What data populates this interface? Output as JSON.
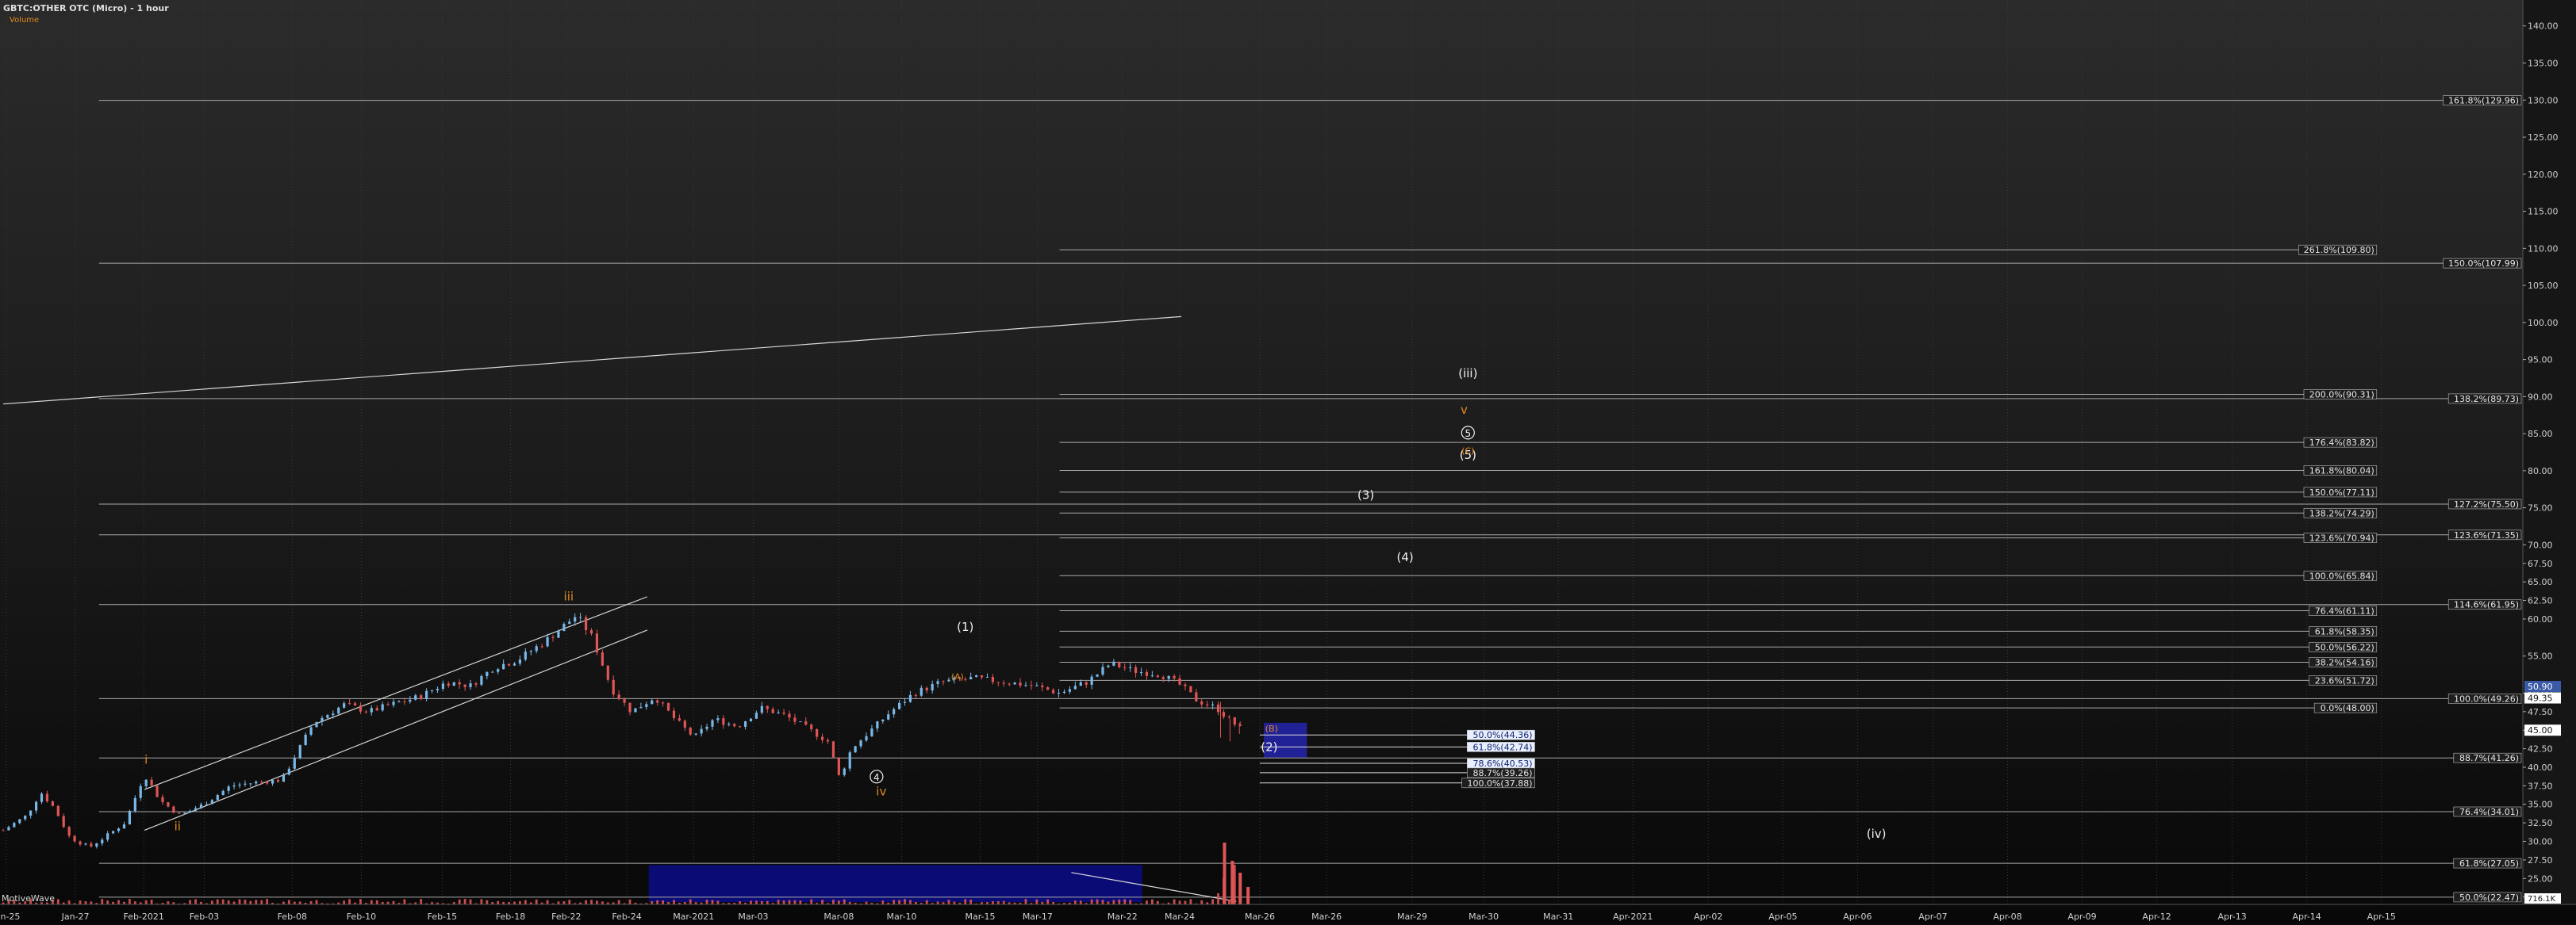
{
  "header": {
    "title": "GBTC:OTHER OTC (Micro) - 1 hour",
    "subtitle": "Volume"
  },
  "watermark": "MotiveWave",
  "colors": {
    "up_candle": "#7ab8e8",
    "down_candle": "#e05555",
    "volume": "#e05555",
    "fib_line": "#a8a8a8",
    "wave_orange": "#e08a1e",
    "wave_white": "#f0f0f0",
    "zone_blue": "#0c0c8a",
    "zone_blue_small": "#2a2ad0",
    "last_price_bg": "#3a5aa8"
  },
  "chart_data": {
    "type": "candlestick",
    "title": "GBTC:OTHER OTC (Micro) - 1 hour",
    "price_range": [
      21.5,
      143.5
    ],
    "y_ticks": [
      "22.50",
      "25.00",
      "27.50",
      "30.00",
      "32.50",
      "35.00",
      "37.50",
      "40.00",
      "42.50",
      "45.00",
      "47.50",
      "50.00",
      "55.00",
      "60.00",
      "62.50",
      "65.00",
      "67.50",
      "70.00",
      "75.00",
      "80.00",
      "85.00",
      "90.00",
      "95.00",
      "100.00",
      "105.00",
      "110.00",
      "115.00",
      "120.00",
      "125.00",
      "130.00",
      "135.00",
      "140.00"
    ],
    "x_ticks": [
      {
        "label": "Jan-25",
        "t": 0.04
      },
      {
        "label": "Jan-27",
        "t": 0.92
      },
      {
        "label": "Feb-2021",
        "t": 1.79
      },
      {
        "label": "Feb-03",
        "t": 2.56
      },
      {
        "label": "Feb-08",
        "t": 3.68
      },
      {
        "label": "Feb-10",
        "t": 4.56
      },
      {
        "label": "Feb-15",
        "t": 5.59
      },
      {
        "label": "Feb-18",
        "t": 6.46
      },
      {
        "label": "Feb-22",
        "t": 7.17
      },
      {
        "label": "Feb-24",
        "t": 7.94
      },
      {
        "label": "Mar-2021",
        "t": 8.79
      },
      {
        "label": "Mar-03",
        "t": 9.55
      },
      {
        "label": "Mar-08",
        "t": 10.64
      },
      {
        "label": "Mar-10",
        "t": 11.44
      },
      {
        "label": "Mar-15",
        "t": 12.44
      },
      {
        "label": "Mar-17",
        "t": 13.17
      },
      {
        "label": "Mar-22",
        "t": 14.25
      },
      {
        "label": "Mar-24",
        "t": 14.98
      },
      {
        "label": "Mar-26",
        "t": 16.0
      },
      {
        "label": "Mar-26",
        "t": 16.85
      },
      {
        "label": "Mar-29",
        "t": 17.94
      },
      {
        "label": "Mar-30",
        "t": 18.85
      },
      {
        "label": "Mar-31",
        "t": 19.8
      },
      {
        "label": "Apr-2021",
        "t": 20.75
      },
      {
        "label": "Apr-02",
        "t": 21.71
      },
      {
        "label": "Apr-05",
        "t": 22.66
      },
      {
        "label": "Apr-06",
        "t": 23.61
      },
      {
        "label": "Apr-07",
        "t": 24.57
      },
      {
        "label": "Apr-08",
        "t": 25.52
      },
      {
        "label": "Apr-09",
        "t": 26.47
      },
      {
        "label": "Apr-12",
        "t": 27.42
      },
      {
        "label": "Apr-13",
        "t": 28.38
      },
      {
        "label": "Apr-14",
        "t": 29.33
      },
      {
        "label": "Apr-15",
        "t": 30.28
      }
    ],
    "price_path": [
      [
        0.0,
        31.5
      ],
      [
        0.3,
        33.5
      ],
      [
        0.48,
        36.6
      ],
      [
        0.65,
        34.5
      ],
      [
        0.85,
        30.5
      ],
      [
        1.1,
        29.2
      ],
      [
        1.35,
        31.0
      ],
      [
        1.55,
        32.5
      ],
      [
        1.8,
        39.0
      ],
      [
        2.0,
        35.5
      ],
      [
        2.25,
        33.5
      ],
      [
        2.55,
        35.0
      ],
      [
        2.9,
        37.5
      ],
      [
        3.25,
        38.0
      ],
      [
        3.55,
        38.3
      ],
      [
        3.95,
        46.0
      ],
      [
        4.35,
        48.5
      ],
      [
        4.65,
        47.5
      ],
      [
        4.95,
        48.5
      ],
      [
        5.3,
        49.5
      ],
      [
        5.65,
        51.5
      ],
      [
        5.95,
        51.0
      ],
      [
        6.25,
        53.5
      ],
      [
        6.55,
        54.5
      ],
      [
        6.9,
        57.0
      ],
      [
        7.3,
        60.5
      ],
      [
        7.5,
        57.5
      ],
      [
        7.75,
        50.5
      ],
      [
        8.0,
        47.5
      ],
      [
        8.3,
        49.5
      ],
      [
        8.55,
        46.5
      ],
      [
        8.8,
        44.0
      ],
      [
        9.05,
        46.5
      ],
      [
        9.35,
        45.5
      ],
      [
        9.65,
        48.0
      ],
      [
        9.95,
        47.0
      ],
      [
        10.2,
        45.5
      ],
      [
        10.5,
        43.5
      ],
      [
        10.65,
        38.5
      ],
      [
        10.8,
        42.5
      ],
      [
        11.0,
        44.5
      ],
      [
        11.3,
        47.5
      ],
      [
        11.6,
        50.0
      ],
      [
        11.95,
        51.5
      ],
      [
        12.35,
        52.0
      ],
      [
        12.75,
        51.5
      ],
      [
        13.1,
        51.0
      ],
      [
        13.45,
        50.0
      ],
      [
        13.8,
        51.5
      ],
      [
        14.1,
        54.0
      ],
      [
        14.4,
        53.0
      ],
      [
        14.75,
        52.5
      ],
      [
        15.0,
        51.0
      ],
      [
        15.2,
        49.0
      ],
      [
        15.45,
        48.0
      ],
      [
        15.6,
        46.5
      ],
      [
        15.8,
        44.8
      ]
    ],
    "zones": [
      {
        "t0": 8.22,
        "t1": 14.5,
        "p0": 21.8,
        "p1": 26.8
      },
      {
        "t0": 16.05,
        "t1": 16.6,
        "p0": 41.3,
        "p1": 46.0
      }
    ],
    "fib_lines_left": [
      {
        "t0": 1.22,
        "p": 129.96,
        "label": "161.8%(129.96)"
      },
      {
        "t0": 1.22,
        "p": 107.99,
        "label": "150.0%(107.99)"
      },
      {
        "t0": 1.22,
        "p": 89.73,
        "label": "138.2%(89.73)"
      },
      {
        "t0": 1.22,
        "p": 75.5,
        "label": "127.2%(75.50)"
      },
      {
        "t0": 1.22,
        "p": 71.35,
        "label": "123.6%(71.35)"
      },
      {
        "t0": 1.22,
        "p": 61.95,
        "label": "114.6%(61.95)"
      },
      {
        "t0": 1.22,
        "p": 49.26,
        "label": "100.0%(49.26)"
      },
      {
        "t0": 1.22,
        "p": 41.26,
        "label": "88.7%(41.26)"
      },
      {
        "t0": 1.22,
        "p": 34.01,
        "label": "76.4%(34.01)"
      },
      {
        "t0": 1.22,
        "p": 27.05,
        "label": "61.8%(27.05)"
      },
      {
        "t0": 1.22,
        "p": 22.47,
        "label": "50.0%(22.47)"
      }
    ],
    "fib_lines_mid": [
      {
        "p": 109.8,
        "label": "261.8%(109.80)"
      },
      {
        "p": 90.31,
        "label": "200.0%(90.31)"
      },
      {
        "p": 83.82,
        "label": "176.4%(83.82)"
      },
      {
        "p": 80.04,
        "label": "161.8%(80.04)"
      },
      {
        "p": 77.11,
        "label": "150.0%(77.11)"
      },
      {
        "p": 74.29,
        "label": "138.2%(74.29)"
      },
      {
        "p": 70.94,
        "label": "123.6%(70.94)"
      },
      {
        "p": 65.84,
        "label": "100.0%(65.84)"
      },
      {
        "p": 61.11,
        "label": "76.4%(61.11)"
      },
      {
        "p": 58.35,
        "label": "61.8%(58.35)"
      },
      {
        "p": 56.22,
        "label": "50.0%(56.22)"
      },
      {
        "p": 54.16,
        "label": "38.2%(54.16)"
      },
      {
        "p": 51.72,
        "label": "23.6%(51.72)"
      },
      {
        "p": 48.0,
        "label": "0.0%(48.00)"
      }
    ],
    "fib_lines_small": [
      {
        "p": 44.36,
        "label": "50.0%(44.36)",
        "highlight": true
      },
      {
        "p": 42.74,
        "label": "61.8%(42.74)",
        "highlight": true
      },
      {
        "p": 40.53,
        "label": "78.6%(40.53)",
        "highlight": true
      },
      {
        "p": 39.26,
        "label": "88.7%(39.26)",
        "highlight": false
      },
      {
        "p": 37.88,
        "label": "100.0%(37.88)",
        "highlight": false
      }
    ],
    "price_tags": [
      {
        "p": 50.9,
        "label": "50.90",
        "bg": "#3a5aa8"
      },
      {
        "p": 49.35,
        "label": "49.35",
        "bg": "#ffffff"
      },
      {
        "p": 45.0,
        "label": "45.00",
        "bg": "#ffffff"
      }
    ],
    "volume_tag": "716.1K",
    "wave_labels": [
      {
        "t": 1.82,
        "p": 40.5,
        "text": "i",
        "color": "orange"
      },
      {
        "t": 2.22,
        "p": 31.5,
        "text": "ii",
        "color": "orange"
      },
      {
        "t": 7.2,
        "p": 62.5,
        "text": "iii",
        "color": "orange"
      },
      {
        "t": 11.18,
        "p": 36.2,
        "text": "iv",
        "color": "orange"
      },
      {
        "t": 11.12,
        "p": 38.2,
        "text": "4",
        "color": "white",
        "circled": true
      },
      {
        "t": 12.25,
        "p": 58.4,
        "text": "(1)",
        "color": "white"
      },
      {
        "t": 12.15,
        "p": 51.8,
        "text": "(A)",
        "color": "orange"
      },
      {
        "t": 16.15,
        "p": 44.8,
        "text": "(B)",
        "color": "orange"
      },
      {
        "t": 16.12,
        "p": 42.2,
        "text": "(2)",
        "color": "white"
      },
      {
        "t": 17.35,
        "p": 76.2,
        "text": "(3)",
        "color": "white"
      },
      {
        "t": 17.85,
        "p": 67.8,
        "text": "(4)",
        "color": "white"
      },
      {
        "t": 18.65,
        "p": 81.6,
        "text": "(5)",
        "color": "white"
      },
      {
        "t": 18.65,
        "p": 84.6,
        "text": "5",
        "color": "white",
        "circled": true
      },
      {
        "t": 18.65,
        "p": 82.3,
        "text": "(C)",
        "color": "orange"
      },
      {
        "t": 18.6,
        "p": 87.7,
        "text": "v",
        "color": "orange"
      },
      {
        "t": 18.65,
        "p": 92.6,
        "text": "(iii)",
        "color": "white"
      },
      {
        "t": 23.85,
        "p": 30.5,
        "text": "(iv)",
        "color": "white"
      }
    ],
    "trend_lines": [
      {
        "t0": 0.0,
        "p0": 89.0,
        "t1": 15.0,
        "p1": 100.8
      },
      {
        "t0": 1.8,
        "p0": 37.0,
        "t1": 8.2,
        "p1": 63.0
      },
      {
        "t0": 1.8,
        "p0": 31.5,
        "t1": 8.2,
        "p1": 58.5
      },
      {
        "t0": 13.6,
        "p0": 25.8,
        "t1": 15.7,
        "p1": 21.9
      }
    ]
  }
}
